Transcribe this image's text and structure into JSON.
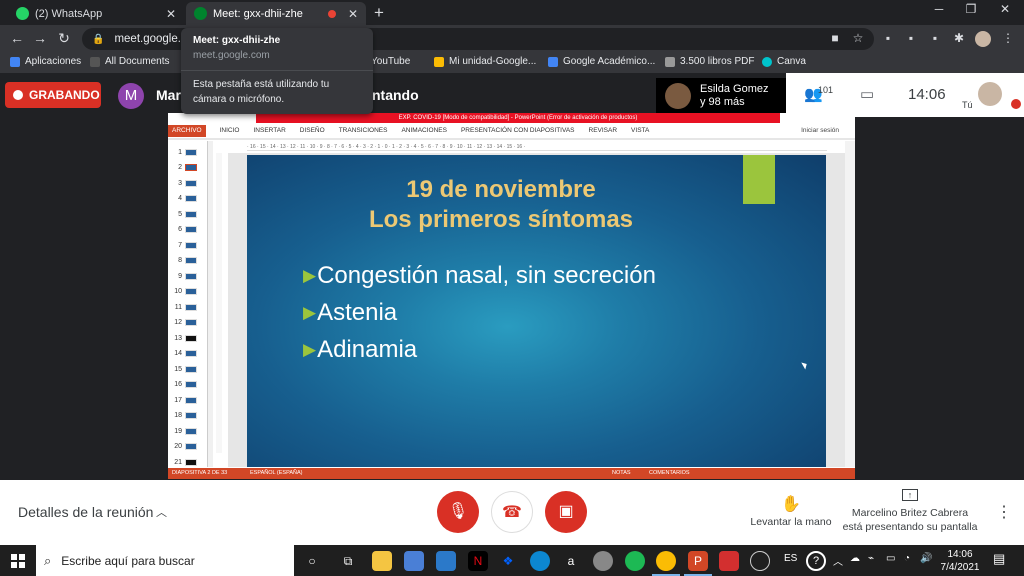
{
  "browser": {
    "tabs": [
      {
        "title": "(2) WhatsApp"
      },
      {
        "title": "Meet: gxx-dhii-zhe"
      }
    ],
    "url": "meet.google.com",
    "bookmarks": [
      "Aplicaciones",
      "All Documents",
      "YouTube",
      "Mi unidad-Google...",
      "Google Académico...",
      "3.500 libros PDF",
      "Canva"
    ],
    "popup": {
      "title": "Meet: gxx-dhii-zhe",
      "url": "meet.google.com",
      "message": "Esta pestaña está utilizando tu cámara o micrófono."
    }
  },
  "meet": {
    "recording_label": "GRABANDO",
    "presenter_initial": "M",
    "presenter_name_partial": "Mar",
    "presenting_partial": "ntando",
    "participants_name": "Esilda Gomez",
    "participants_more": "y 98 más",
    "participant_count": "101",
    "time": "14:06",
    "self_label": "Tú",
    "details_label": "Detalles de la reunión",
    "raise_hand_label": "Levantar la mano",
    "presenting_name": "Marcelino Britez Cabrera",
    "presenting_status": "está presentando su pantalla"
  },
  "ppt": {
    "window_title": "EXP. COVID-19 [Modo de compatibilidad] - PowerPoint (Error de activación de productos)",
    "ribbon_tabs": [
      "ARCHIVO",
      "INICIO",
      "INSERTAR",
      "DISEÑO",
      "TRANSICIONES",
      "ANIMACIONES",
      "PRESENTACIÓN CON DIAPOSITIVAS",
      "REVISAR",
      "VISTA"
    ],
    "sign_in": "Iniciar sesión",
    "ruler": "· 16 · 15 · 14 · 13 · 12 · 11 · 10 · 9 · 8 · 7 · 6 · 5 · 4 · 3 · 2 · 1 · 0 · 1 · 2 · 3 · 4 · 5 · 6 · 7 · 8 · 9 · 10 · 11 · 12 · 13 · 14 · 15 · 16 ·",
    "thumb_numbers": [
      "1",
      "2",
      "3",
      "4",
      "5",
      "6",
      "7",
      "8",
      "9",
      "10",
      "11",
      "12",
      "13",
      "14",
      "15",
      "16",
      "17",
      "18",
      "19",
      "20",
      "21"
    ],
    "slide": {
      "title_line1": "19 de noviembre",
      "title_line2": "Los primeros síntomas",
      "bullets": [
        "Congestión nasal, sin secreción",
        "Astenia",
        "Adinamia"
      ]
    },
    "status_slide": "DIAPOSITIVA 2 DE 33",
    "status_lang": "ESPAÑOL (ESPAÑA)",
    "status_notes": "NOTAS",
    "status_comments": "COMENTARIOS"
  },
  "taskbar": {
    "search_placeholder": "Escribe aquí para buscar",
    "lang": "ES",
    "time": "14:06",
    "date": "7/4/2021"
  },
  "colors": {
    "recording": "#d93025",
    "slide_title": "#ecc874",
    "slide_accent": "#9bc53d",
    "ppt_orange": "#d24726"
  }
}
